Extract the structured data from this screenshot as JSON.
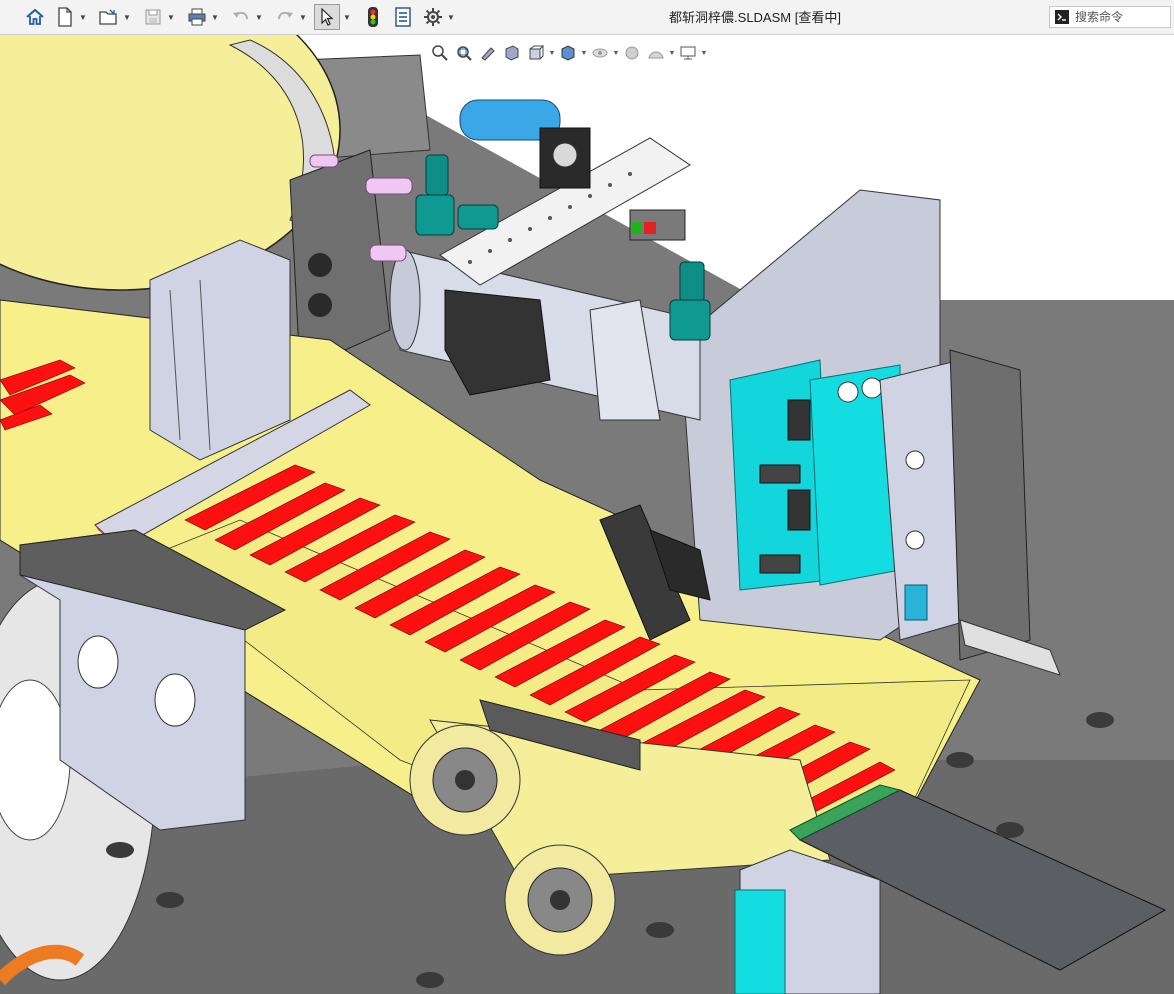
{
  "app": {
    "title": "都斩洞梓儂.SLDASM [查看中]"
  },
  "toolbar": {
    "icons": [
      "home-icon",
      "new-document-icon",
      "open-folder-icon",
      "save-icon",
      "print-icon",
      "undo-icon",
      "redo-icon",
      "select-arrow-icon",
      "rebuild-traffic-light-icon",
      "file-properties-icon",
      "options-gear-icon"
    ]
  },
  "search": {
    "placeholder": "搜索命令"
  },
  "heads_up_toolbar": {
    "icons": [
      "zoom-to-fit-icon",
      "zoom-to-area-icon",
      "previous-view-icon",
      "section-view-icon",
      "view-orientation-icon",
      "display-style-icon",
      "hide-show-items-icon",
      "edit-appearance-icon",
      "apply-scene-icon",
      "view-settings-icon"
    ]
  },
  "colors": {
    "toolbar_bg": "#f3f3f3",
    "label_yellow": "#f7f08a",
    "label_red": "#ff1010",
    "frame_gray": "#6e6e6e",
    "plate_light": "#cfd3e3",
    "cyan_part": "#12d6dc",
    "teal_fitting": "#0f8e86",
    "blue_cylinder": "#3aa8e6",
    "orange_cable": "#ee7a22"
  }
}
